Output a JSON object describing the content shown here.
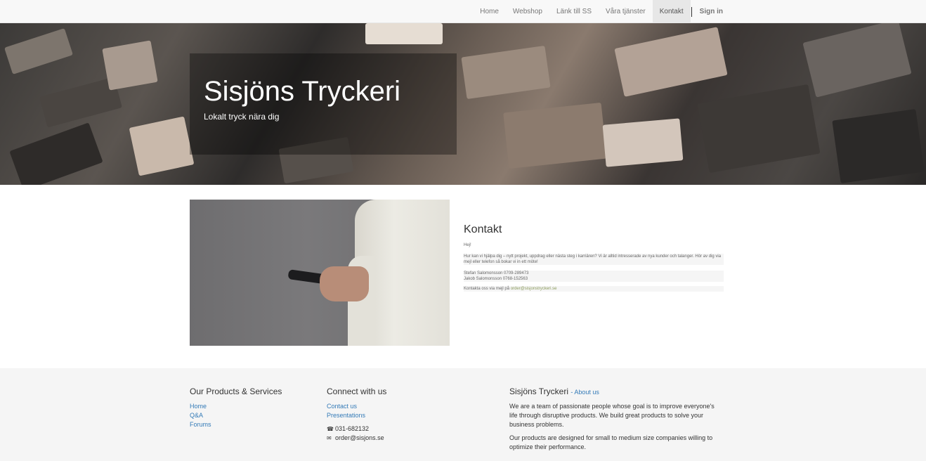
{
  "nav": {
    "items": [
      "Home",
      "Webshop",
      "Länk till SS",
      "Våra tjänster",
      "Kontakt"
    ],
    "sign_in": "Sign in"
  },
  "hero": {
    "title": "Sisjöns Tryckeri",
    "subtitle": "Lokalt tryck nära dig"
  },
  "contact": {
    "heading": "Kontakt",
    "greeting": "Hej!",
    "intro": "Hur kan vi hjälpa dig – nytt projekt, uppdrag eller nästa steg i karriären? Vi är alltid intresserade av nya kunder och talanger. Hör av dig via mejl eller telefon så bokar vi in ett möte!",
    "person1": "Stefan Salomonsson 0709-289473",
    "person2": "Jakob Salomonsson 0768-152563",
    "mail_prefix": "Kontakta oss via mejl på ",
    "mail_link": "order@sisjonstryckeri.se"
  },
  "footer": {
    "products_heading": "Our Products & Services",
    "products_links": [
      "Home",
      "Q&A",
      "Forums"
    ],
    "connect_heading": "Connect with us",
    "connect_links": [
      "Contact us",
      "Presentations"
    ],
    "phone": "031-682132",
    "email": "order@sisjons.se",
    "about_heading": "Sisjöns Tryckeri",
    "about_link": "- About us",
    "about_p1": "We are a team of passionate people whose goal is to improve everyone's life through disruptive products. We build great products to solve your business problems.",
    "about_p2": "Our products are designed for small to medium size companies willing to optimize their performance."
  },
  "icons": {
    "phone": "phone-icon",
    "email": "envelope-icon"
  }
}
